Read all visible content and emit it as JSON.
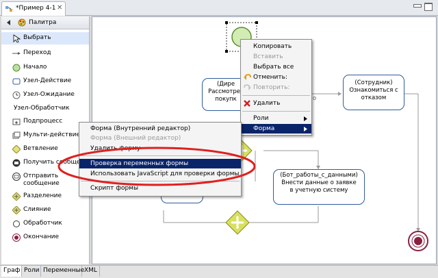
{
  "editor_tab": {
    "title": "*Пример 4-1",
    "close": "✕"
  },
  "palette": {
    "title": "Палитра",
    "items": [
      {
        "label": "Выбрать",
        "icon": "pointer-icon"
      },
      {
        "label": "Переход",
        "icon": "arrow-icon"
      },
      {
        "label": "Начало",
        "icon": "start-node-icon"
      },
      {
        "label": "Узел-Действие",
        "icon": "action-node-icon"
      },
      {
        "label": "Узел-Ожидание",
        "icon": "wait-node-icon"
      },
      {
        "label": "Узел-Обработчик",
        "icon": ""
      },
      {
        "label": "Подпроцесс",
        "icon": "subprocess-icon"
      },
      {
        "label": "Мульти-действие",
        "icon": "multi-action-icon"
      },
      {
        "label": "Ветвление",
        "icon": "decision-icon"
      },
      {
        "label": "Получить сообщение",
        "icon": "receive-message-icon"
      },
      {
        "label": "Отправить сообщение",
        "icon": "send-message-icon"
      },
      {
        "label": "Разделение",
        "icon": "fork-icon"
      },
      {
        "label": "Слияние",
        "icon": "join-icon"
      },
      {
        "label": "Обработчик",
        "icon": "handler-icon"
      },
      {
        "label": "Окончание",
        "icon": "end-node-icon"
      }
    ]
  },
  "nodes": {
    "director_title": "(Дире",
    "director_text": "Рассмотрет",
    "director_text2": "покупк",
    "employee_title": "(Сотрудник)",
    "employee_text": "Ознакомиться с отказом",
    "bot_title": "(Бот_работы_с_данными)",
    "bot_text": "Внести данные о заявке в учетную систему",
    "edge_label_fragment": "о"
  },
  "context_menu": {
    "copy": "Копировать",
    "paste": "Вставить",
    "select_all": "Выбрать все",
    "undo": "Отменить:",
    "redo": "Повторить:",
    "delete": "Удалить",
    "roles": "Роли",
    "form": "Форма"
  },
  "form_submenu": {
    "internal_editor": "Форма (Внутренний редактор)",
    "external_editor": "Форма (Внешний редактор)",
    "delete_form": "Удалить форму",
    "check_vars": "Проверка переменных формы",
    "use_js": "Использовать JavaScript для проверки формы",
    "form_script": "Скрипт формы"
  },
  "bottom_tabs": [
    "Граф",
    "Роли",
    "Переменные",
    "XML"
  ],
  "colors": {
    "accent": "#0a246a",
    "node_border": "#2f5b9a",
    "highlight_ellipse": "#e02020",
    "gateway": "#a8b61e"
  }
}
